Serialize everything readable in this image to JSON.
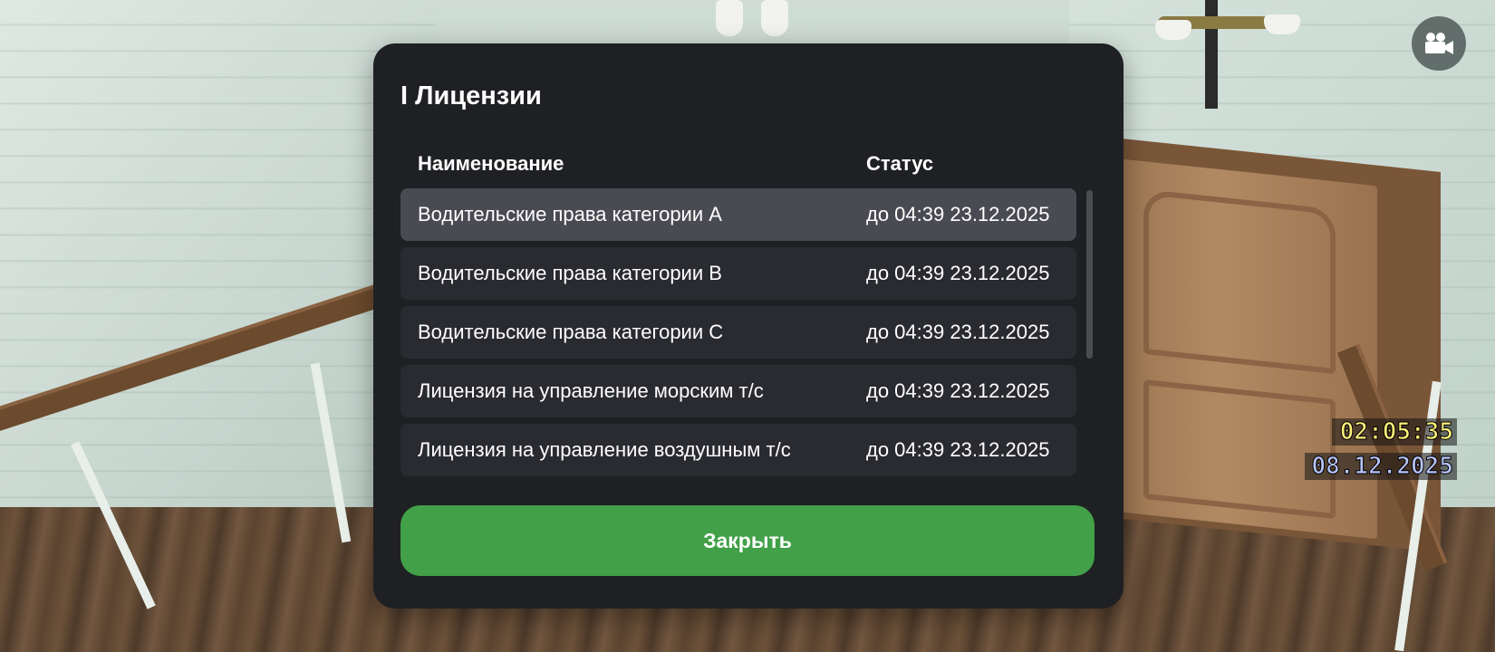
{
  "hud": {
    "time": "02:05:35",
    "date": "08.12.2025",
    "camera_icon": "video-camera-icon"
  },
  "modal": {
    "title": "I Лицензии",
    "columns": {
      "name": "Наименование",
      "status": "Статус"
    },
    "rows": [
      {
        "name": "Водительские права категории A",
        "status": "до 04:39 23.12.2025",
        "selected": true
      },
      {
        "name": "Водительские права категории B",
        "status": "до 04:39 23.12.2025",
        "selected": false
      },
      {
        "name": "Водительские права категории C",
        "status": "до 04:39 23.12.2025",
        "selected": false
      },
      {
        "name": "Лицензия на управление морским т/с",
        "status": "до 04:39 23.12.2025",
        "selected": false
      },
      {
        "name": "Лицензия на управление воздушным т/с",
        "status": "до 04:39 23.12.2025",
        "selected": false
      }
    ],
    "close_label": "Закрыть"
  },
  "colors": {
    "modal_bg": "#1f2023",
    "row_bg": "#2a2b30",
    "row_selected_bg": "#4a4b52",
    "close_button_bg": "#41a048",
    "time_color": "#fff27a",
    "date_color": "#b9c6ff"
  }
}
